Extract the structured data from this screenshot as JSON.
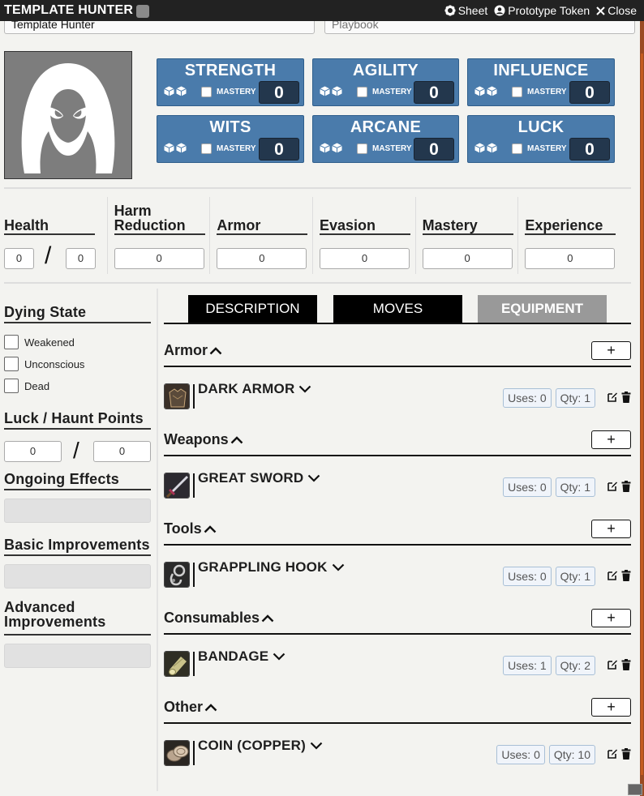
{
  "window": {
    "title": "TEMPLATE HUNTER",
    "actions": {
      "sheet": "Sheet",
      "prototype": "Prototype Token",
      "close": "Close"
    }
  },
  "header": {
    "name_value": "Template Hunter",
    "playbook_placeholder": "Playbook"
  },
  "stats": [
    {
      "label": "STRENGTH",
      "mastery_label": "MASTERY",
      "value": "0"
    },
    {
      "label": "AGILITY",
      "mastery_label": "MASTERY",
      "value": "0"
    },
    {
      "label": "INFLUENCE",
      "mastery_label": "MASTERY",
      "value": "0"
    },
    {
      "label": "WITS",
      "mastery_label": "MASTERY",
      "value": "0"
    },
    {
      "label": "ARCANE",
      "mastery_label": "MASTERY",
      "value": "0"
    },
    {
      "label": "LUCK",
      "mastery_label": "MASTERY",
      "value": "0"
    }
  ],
  "attributes": {
    "health": {
      "label": "Health",
      "value": "0",
      "max": "0"
    },
    "harm_reduction": {
      "label": "Harm Reduction",
      "value": "0"
    },
    "armor": {
      "label": "Armor",
      "value": "0"
    },
    "evasion": {
      "label": "Evasion",
      "value": "0"
    },
    "mastery": {
      "label": "Mastery",
      "value": "0"
    },
    "experience": {
      "label": "Experience",
      "value": "0"
    }
  },
  "sidebar": {
    "dying_state": {
      "label": "Dying State",
      "options": [
        "Weakened",
        "Unconscious",
        "Dead"
      ]
    },
    "luck_haunt": {
      "label": "Luck / Haunt Points",
      "value": "0",
      "max": "0"
    },
    "ongoing_effects": {
      "label": "Ongoing Effects"
    },
    "basic_improvements": {
      "label": "Basic Improvements"
    },
    "advanced_improvements": {
      "label": "Advanced Improvements"
    }
  },
  "tabs": [
    {
      "label": "DESCRIPTION",
      "active": false
    },
    {
      "label": "MOVES",
      "active": false
    },
    {
      "label": "EQUIPMENT",
      "active": true
    }
  ],
  "equipment": {
    "add_label": "+",
    "categories": [
      {
        "title": "Armor",
        "item": {
          "name": "DARK ARMOR",
          "uses": "Uses: 0",
          "qty": "Qty: 1",
          "icon": "armor-icon"
        }
      },
      {
        "title": "Weapons",
        "item": {
          "name": "GREAT SWORD",
          "uses": "Uses: 0",
          "qty": "Qty: 1",
          "icon": "sword-icon"
        }
      },
      {
        "title": "Tools",
        "item": {
          "name": "GRAPPLING HOOK",
          "uses": "Uses: 0",
          "qty": "Qty: 1",
          "icon": "hook-icon"
        }
      },
      {
        "title": "Consumables",
        "item": {
          "name": "BANDAGE",
          "uses": "Uses: 1",
          "qty": "Qty: 2",
          "icon": "bandage-icon"
        }
      },
      {
        "title": "Other",
        "item": {
          "name": "COIN (COPPER)",
          "uses": "Uses: 0",
          "qty": "Qty: 10",
          "icon": "coin-icon"
        }
      }
    ]
  },
  "colors": {
    "stat_blue": "#4a7bab",
    "stat_value_bg": "#23374d",
    "tab_active": "#999999",
    "scrollbar": "#c45a1f"
  }
}
